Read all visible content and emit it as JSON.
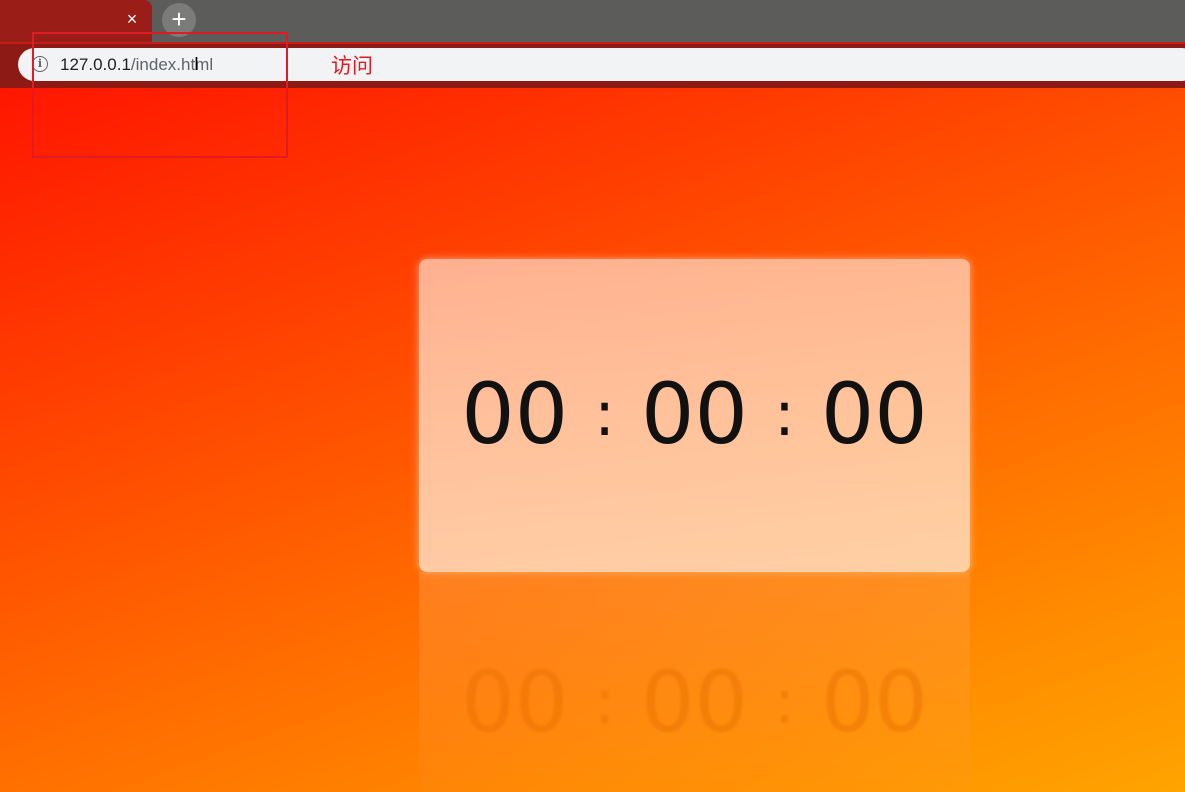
{
  "browser": {
    "tab": {
      "close_glyph": "×"
    },
    "new_tab_glyph": "+",
    "address_bar": {
      "host": "127.0.0.1",
      "path": "/index.html",
      "info_glyph": "i"
    },
    "cursor_glyph": "I"
  },
  "annotation": {
    "label": "访问",
    "color": "#e11b22"
  },
  "timer": {
    "hours": "00",
    "minutes": "00",
    "seconds": "00",
    "separator": ":"
  },
  "colors": {
    "gradient_start": "#ff1600",
    "gradient_end": "#ffa400",
    "tab_active": "#9a1d17",
    "tabstrip": "#5c5c5a"
  }
}
